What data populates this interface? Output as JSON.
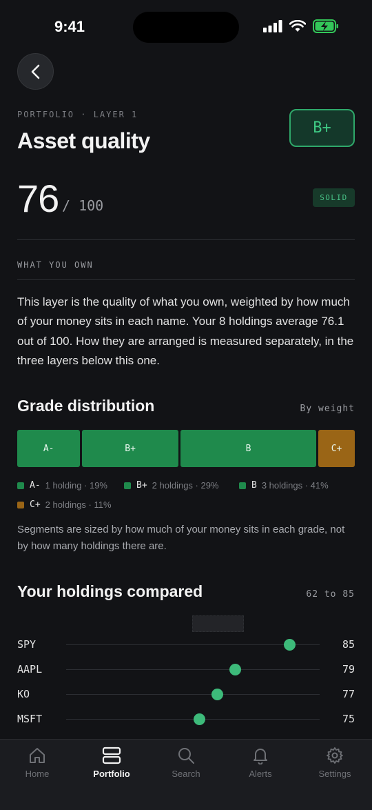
{
  "status_bar": {
    "time": "9:41"
  },
  "header": {
    "eyebrow": "PORTFOLIO · LAYER 1",
    "title": "Asset quality",
    "grade": "B+",
    "score": "76",
    "score_max": "/ 100",
    "rating": "SOLID"
  },
  "section": {
    "label": "WHAT YOU OWN",
    "paragraph": "This layer is the quality of what you own, weighted by how much of your money sits in each name. Your 8 holdings average 76.1 out of 100. How they are arranged is measured separately, in the three layers below this one."
  },
  "distribution": {
    "title": "Grade distribution",
    "meta": "By weight",
    "segments": [
      {
        "grade": "A-",
        "weight_pct": 19,
        "color": "#1F8A4C"
      },
      {
        "grade": "B+",
        "weight_pct": 29,
        "color": "#1F8A4C"
      },
      {
        "grade": "B",
        "weight_pct": 41,
        "color": "#1F8A4C"
      },
      {
        "grade": "C+",
        "weight_pct": 11,
        "color": "#9A6516"
      }
    ],
    "legend": [
      {
        "grade": "A-",
        "text": "1 holding · 19%",
        "color": "#1F8A4C"
      },
      {
        "grade": "B+",
        "text": "2 holdings · 29%",
        "color": "#1F8A4C"
      },
      {
        "grade": "B",
        "text": "3 holdings · 41%",
        "color": "#1F8A4C"
      },
      {
        "grade": "C+",
        "text": "2 holdings · 11%",
        "color": "#9A6516"
      }
    ],
    "note": "Segments are sized by how much of your money sits in each grade, not by how many holdings there are."
  },
  "holdings": {
    "title": "Your holdings compared",
    "range": "62 to 85",
    "range_min": 62,
    "range_max": 85,
    "rows": [
      {
        "ticker": "SPY",
        "score": 85
      },
      {
        "ticker": "AAPL",
        "score": 79
      },
      {
        "ticker": "KO",
        "score": 77
      },
      {
        "ticker": "MSFT",
        "score": 75
      }
    ]
  },
  "tabbar": {
    "items": [
      {
        "label": "Home",
        "icon": "home-icon"
      },
      {
        "label": "Portfolio",
        "icon": "portfolio-icon",
        "active": true
      },
      {
        "label": "Search",
        "icon": "search-icon"
      },
      {
        "label": "Alerts",
        "icon": "bell-icon"
      },
      {
        "label": "Settings",
        "icon": "gear-icon"
      }
    ]
  },
  "colors": {
    "accent": "#3DBA7A",
    "background": "#121316",
    "warning": "#9A6516"
  }
}
